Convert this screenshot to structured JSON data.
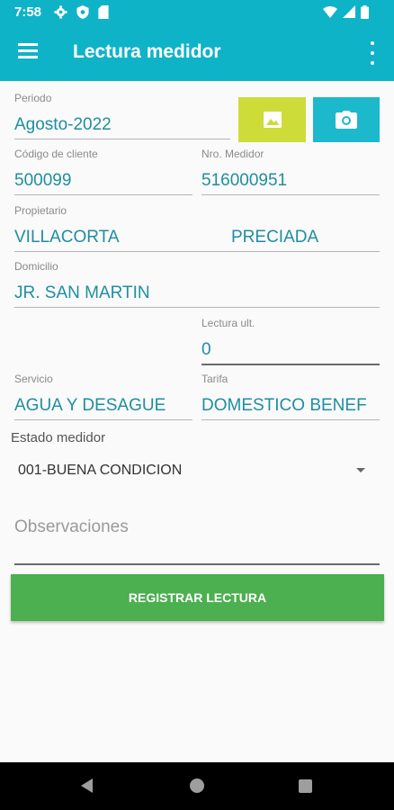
{
  "status_bar": {
    "time": "7:58",
    "left_icons": [
      "gear-icon",
      "shield-icon",
      "sd-card-icon"
    ],
    "right_icons": [
      "wifi-icon",
      "signal-icon",
      "battery-icon"
    ]
  },
  "app_bar": {
    "title": "Lectura medidor",
    "color": "#0fb3c7"
  },
  "form": {
    "periodo": {
      "label": "Periodo",
      "value": "Agosto-2022"
    },
    "codigo_cliente": {
      "label": "Código de cliente",
      "value": "500099"
    },
    "nro_medidor": {
      "label": "Nro. Medidor",
      "value": "516000951"
    },
    "propietario": {
      "label": "Propietario",
      "value_first": "VILLACORTA",
      "value_last": "PRECIADA"
    },
    "domicilio": {
      "label": "Domicilio",
      "value": "JR. SAN MARTIN"
    },
    "lectura_ult": {
      "label": "Lectura ult.",
      "value": "0"
    },
    "servicio": {
      "label": "Servicio",
      "value": "AGUA Y DESAGUE"
    },
    "tarifa": {
      "label": "Tarifa",
      "value": "DOMESTICO BENEF"
    },
    "estado_medidor": {
      "label": "Estado medidor",
      "selected": "001-BUENA CONDICION"
    },
    "observaciones": {
      "placeholder": "Observaciones",
      "value": ""
    }
  },
  "buttons": {
    "image": {
      "icon": "image-icon",
      "color": "#cddc39"
    },
    "camera": {
      "icon": "camera-icon",
      "color": "#1cb8cb"
    },
    "register": {
      "label": "REGISTRAR LECTURA",
      "color": "#4caf50"
    }
  },
  "nav_bar": {
    "icons": [
      "back-icon",
      "home-icon",
      "recents-icon"
    ]
  }
}
